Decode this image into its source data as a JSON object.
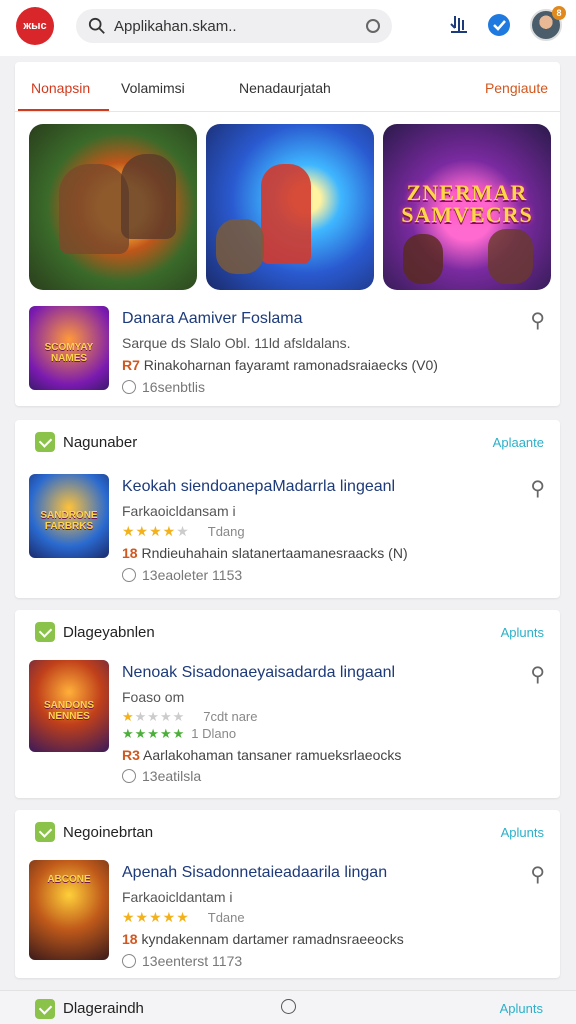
{
  "header": {
    "logo_text": "жыc",
    "search_placeholder": "Applikahan.skam..",
    "notification_count": "8",
    "icons": [
      "search-icon",
      "mic-icon",
      "download-icon",
      "verified-icon",
      "avatar"
    ]
  },
  "tabs": {
    "items": [
      "Nonapsin",
      "Volamimsi",
      "Nenadaurjatah"
    ],
    "active": "Nonapsin",
    "right_label": "Pengiaute"
  },
  "banners": [
    {
      "title": ""
    },
    {
      "title": ""
    },
    {
      "title": "ZNERMAR SAMVECRS"
    }
  ],
  "featured_app": {
    "title": "Danara Aamiver Foslama",
    "subtitle": "Sarque ds Slalo Obl. 11ld afsldalans.",
    "rank": "R7",
    "detail": "Rinakoharnan fayaramt ramonadsraiaecks (V0)",
    "meta": "16senbtlis",
    "thumb_title": "SCOMYAY NAMES"
  },
  "sections": [
    {
      "title": "Nagunaber",
      "link": "Aplaante",
      "app": {
        "title": "Keokah siendoanepaMadarrla lingeanl",
        "subtitle": "Farkaoicldansam i",
        "stars": 4,
        "stars_label": "Tdang",
        "rank": "18",
        "detail": "Rndieuhahain slatanertaamanesraacks (N)",
        "meta": "13eaoleter 1153",
        "thumb_title": "SANDRONE FARBRKS"
      }
    },
    {
      "title": "Dlageyabnlen",
      "link": "Aplunts",
      "app": {
        "title": "Nenoak Sisadonaeyaisadarda lingaanl",
        "subtitle": "Foaso om",
        "stars": 1,
        "stars_label": "7cdt nare",
        "stars2": 5,
        "stars2_label": "1 Dlano",
        "rank": "R3",
        "detail": "Aarlakohaman tansaner ramueksrlaeocks",
        "meta": "13eatilsla",
        "thumb_title": "SANDONS NENNES"
      }
    },
    {
      "title": "Negoinebrtan",
      "link": "Aplunts",
      "app": {
        "title": "Apenah Sisadonnetaieadaarila lingan",
        "subtitle": "Farkaoicldantam i",
        "stars": 5,
        "stars_label": "Tdane",
        "rank": "18",
        "detail": "kyndakennam dartamer ramadnsraeeocks",
        "meta": "13eenterst 1173",
        "thumb_title": "ABCONE"
      }
    },
    {
      "title": "Dlageraindh",
      "link": "Aplunts"
    }
  ],
  "colors": {
    "accent": "#d23a1e",
    "link": "#2bb0c9",
    "title": "#1d3a7a",
    "star": "#f3b21c"
  }
}
